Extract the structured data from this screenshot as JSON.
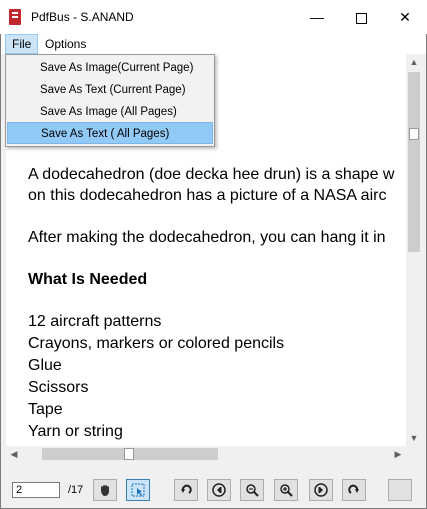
{
  "window": {
    "title": "PdfBus - S.ANAND",
    "minimize_glyph": "—",
    "close_glyph": "✕"
  },
  "menubar": {
    "file_label": "File",
    "options_label": "Options"
  },
  "file_menu": {
    "items": [
      "Save As Image(Current Page)",
      "Save As Text (Current Page)",
      "Save As Image (All Pages)",
      "Save As Text ( All Pages)"
    ],
    "selected_index": 3
  },
  "document": {
    "lines": [
      "A dodecahedron (doe decka hee drun) is a shape w",
      "on this dodecahedron has a picture of a NASA airc",
      "After making the dodecahedron, you can hang it in",
      "What Is Needed",
      "12 aircraft patterns",
      "Crayons, markers or colored pencils",
      "Glue",
      "Scissors",
      "Tape",
      "Yarn or string"
    ]
  },
  "toolbar": {
    "page_value": "2",
    "page_total": "/17",
    "icons": [
      "hand-tool-icon",
      "select-tool-icon",
      "rotate-left-icon",
      "previous-page-icon",
      "zoom-out-icon",
      "zoom-in-icon",
      "next-page-icon",
      "rotate-right-icon"
    ]
  },
  "colors": {
    "menu_highlight": "#91c9f7",
    "menubar_active": "#cce4f7",
    "app_icon": "#c0282d"
  }
}
